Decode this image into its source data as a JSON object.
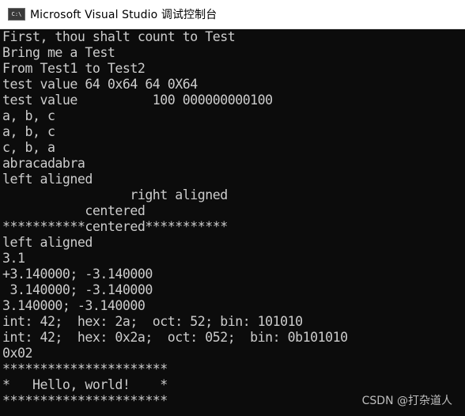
{
  "window": {
    "title": "Microsoft Visual Studio 调试控制台",
    "icon_text": "C:\\"
  },
  "console": {
    "lines": [
      "First, thou shalt count to Test",
      "Bring me a Test",
      "From Test1 to Test2",
      "test value 64 0x64 64 0X64",
      "test value          100 000000000100",
      "a, b, c",
      "a, b, c",
      "c, b, a",
      "abracadabra",
      "left aligned",
      "                 right aligned",
      "           centered",
      "***********centered***********",
      "left aligned",
      "3.1",
      "+3.140000; -3.140000",
      " 3.140000; -3.140000",
      "3.140000; -3.140000",
      "int: 42;  hex: 2a;  oct: 52; bin: 101010",
      "int: 42;  hex: 0x2a;  oct: 052;  bin: 0b101010",
      "0x02",
      "**********************",
      "*   Hello, world!    *",
      "**********************"
    ]
  },
  "watermark": "CSDN @打杂道人",
  "colors": {
    "background": "#0c0c0c",
    "text": "#cccccc",
    "titlebar": "#ffffff"
  }
}
